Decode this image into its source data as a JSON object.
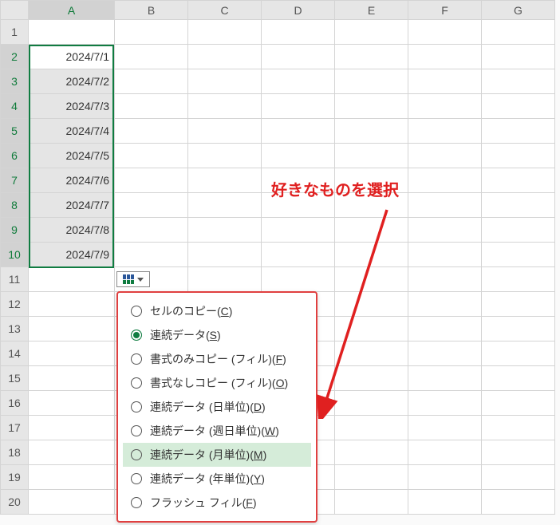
{
  "columns": [
    "A",
    "B",
    "C",
    "D",
    "E",
    "F",
    "G"
  ],
  "rows_count": 20,
  "data_cells": [
    "2024/7/1",
    "2024/7/2",
    "2024/7/3",
    "2024/7/4",
    "2024/7/5",
    "2024/7/6",
    "2024/7/7",
    "2024/7/8",
    "2024/7/9"
  ],
  "callout_text": "好きなものを選択",
  "menu": {
    "items": [
      {
        "label": "セルのコピー",
        "accel": "C",
        "selected": false,
        "hl": false
      },
      {
        "label": "連続データ",
        "accel": "S",
        "selected": true,
        "hl": false
      },
      {
        "label": "書式のみコピー (フィル)",
        "accel": "F",
        "selected": false,
        "hl": false
      },
      {
        "label": "書式なしコピー (フィル)",
        "accel": "O",
        "selected": false,
        "hl": false
      },
      {
        "label": "連続データ (日単位)",
        "accel": "D",
        "selected": false,
        "hl": false
      },
      {
        "label": "連続データ (週日単位)",
        "accel": "W",
        "selected": false,
        "hl": false
      },
      {
        "label": "連続データ (月単位)",
        "accel": "M",
        "selected": false,
        "hl": true
      },
      {
        "label": "連続データ (年単位)",
        "accel": "Y",
        "selected": false,
        "hl": false
      },
      {
        "label": "フラッシュ フィル",
        "accel": "F",
        "selected": false,
        "hl": false
      }
    ]
  }
}
